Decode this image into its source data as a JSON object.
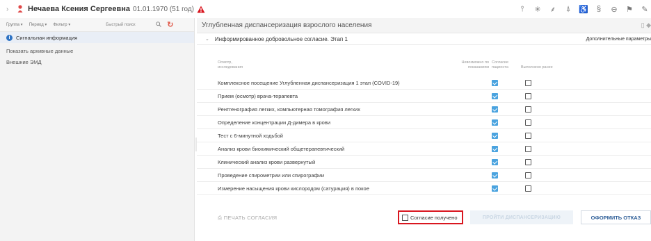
{
  "patient": {
    "name": "Нечаева Ксения Сергеевна",
    "birth": "01.01.1970 (51 год)"
  },
  "colors": {
    "accent": "#2f73c4",
    "checkbox_on": "#4aa3df",
    "warning": "#d9161f",
    "refuse_text": "#2f5f98"
  },
  "left": {
    "toolbar": {
      "group": "Группа ▾",
      "period": "Период ▾",
      "filter": "Фильтр ▾",
      "search_placeholder": "Быстрый поиск"
    },
    "signal_label": "Сигнальная информация",
    "links": [
      "Показать архивные данные",
      "Внешние ЭМД"
    ]
  },
  "main": {
    "title": "Углубленная диспансеризация взрослого населения",
    "section_title": "Информированное добровольное согласие. Этап 1",
    "section_extra": "Дополнительные параметры",
    "columns": {
      "exam": "Осмотр,",
      "exam2": "исследования",
      "impossible": "Невозможно по",
      "impossible2": "показаниям",
      "consent": "Согласие",
      "consent2": "пациента",
      "done": "Выполнено ранее"
    },
    "rows": [
      {
        "name": "Комплексное посещение Углубленная диспансеризация 1 этап (COVID-19)",
        "consent": true,
        "done": false
      },
      {
        "name": "Прием (осмотр) врача-терапевта",
        "consent": true,
        "done": false
      },
      {
        "name": "Рентгенография легких, компьютерная томография легких",
        "consent": true,
        "done": false
      },
      {
        "name": "Определение концентрации Д-димера в крови",
        "consent": true,
        "done": false
      },
      {
        "name": "Тест с 6-минутной ходьбой",
        "consent": true,
        "done": false
      },
      {
        "name": "Анализ крови биохимический общетерапевтический",
        "consent": true,
        "done": false
      },
      {
        "name": "Клинический анализ крови развернутый",
        "consent": true,
        "done": false
      },
      {
        "name": "Проведение спирометрии или спирографии",
        "consent": true,
        "done": false
      },
      {
        "name": "Измерение насыщения крови кислородом (сатурация) в покое",
        "consent": true,
        "done": false
      }
    ],
    "print_label": "ПЕЧАТЬ СОГЛАСИЯ",
    "consent_received_label": "Согласие получено",
    "pass_label": "ПРОЙТИ ДИСПАНСЕРИЗАЦИЮ",
    "refuse_label": "ОФОРМИТЬ ОТКАЗ"
  },
  "icons": [
    "chevron-right-icon",
    "person-icon",
    "warning-icon",
    "info-icon",
    "search-icon",
    "refresh-icon",
    "chevron-down-icon",
    "printer-icon"
  ]
}
